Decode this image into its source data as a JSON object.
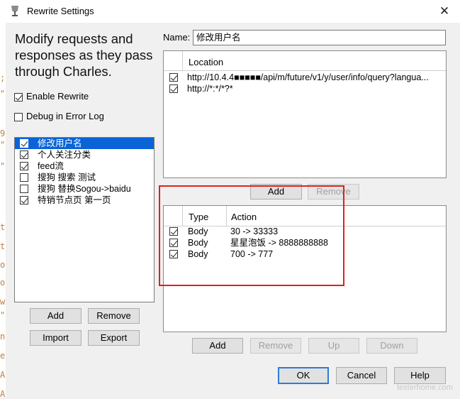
{
  "window": {
    "title": "Rewrite Settings",
    "close_glyph": "✕"
  },
  "intro": "Modify requests and responses as they pass through Charles.",
  "options": {
    "enable_rewrite": {
      "label": "Enable Rewrite",
      "checked": true
    },
    "debug_log": {
      "label": "Debug in Error Log",
      "checked": false
    }
  },
  "rules": [
    {
      "label": "修改用户名",
      "checked": true,
      "selected": true
    },
    {
      "label": "个人关注分类",
      "checked": true,
      "selected": false
    },
    {
      "label": "feed流",
      "checked": true,
      "selected": false
    },
    {
      "label": "搜狗 搜索 测试",
      "checked": false,
      "selected": false
    },
    {
      "label": "搜狗 替换Sogou->baidu",
      "checked": false,
      "selected": false
    },
    {
      "label": "特销节点页 第一页",
      "checked": true,
      "selected": false
    }
  ],
  "left_buttons": {
    "add": "Add",
    "remove": "Remove",
    "import": "Import",
    "export": "Export"
  },
  "name": {
    "label": "Name:",
    "value": "修改用户名"
  },
  "locations": {
    "header": "Location",
    "rows": [
      {
        "checked": true,
        "url": "http://10.4.4■■■■■/api/m/future/v1/y/user/info/query?langua..."
      },
      {
        "checked": true,
        "url": "http://*:*/*?*"
      }
    ],
    "add": "Add",
    "remove": "Remove"
  },
  "actions": {
    "headers": {
      "type": "Type",
      "action": "Action"
    },
    "rows": [
      {
        "checked": true,
        "type": "Body",
        "action": "30 -> 33333"
      },
      {
        "checked": true,
        "type": "Body",
        "action": "星星泡饭 -> 8888888888"
      },
      {
        "checked": true,
        "type": "Body",
        "action": "700 -> 777"
      }
    ],
    "buttons": {
      "add": "Add",
      "remove": "Remove",
      "up": "Up",
      "down": "Down"
    }
  },
  "dialog_buttons": {
    "ok": "OK",
    "cancel": "Cancel",
    "help": "Help"
  },
  "watermark": "testerhome.com",
  "background_editor_chars": [
    ";",
    "\"",
    "9",
    "\"",
    "\"",
    "t",
    "t",
    "o",
    "o",
    "w",
    "\"",
    "n",
    "e",
    "A",
    "A"
  ],
  "colors": {
    "selection": "#0a64d8",
    "highlight_box": "#e0201c",
    "primary_border": "#2e7bd6"
  }
}
